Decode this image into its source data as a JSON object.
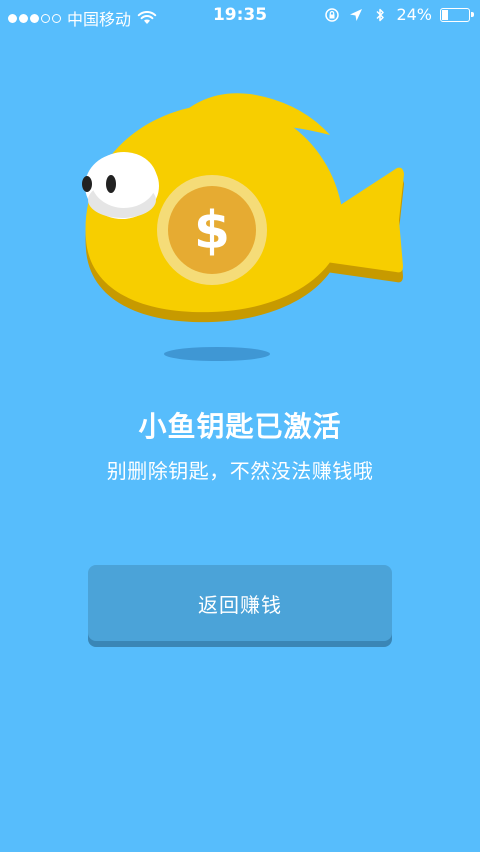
{
  "status_bar": {
    "carrier": "中国移动",
    "time": "19:35",
    "battery_percent": "24%",
    "battery_level": 0.24,
    "icons": [
      "signal-dots",
      "wifi-icon",
      "orientation-lock-icon",
      "location-arrow-icon",
      "bluetooth-icon",
      "battery-icon"
    ]
  },
  "illustration": {
    "name": "yellow-fish-with-dollar-coin",
    "coin_symbol": "$",
    "colors": {
      "background": "#57bdfc",
      "fish_body": "#f7ce00",
      "fish_shadow": "#c79a00",
      "coin_outer": "#f5dc78",
      "coin_inner": "#e6ab32"
    }
  },
  "main": {
    "title": "小鱼钥匙已激活",
    "subtitle": "别删除钥匙，不然没法赚钱哦"
  },
  "actions": {
    "return_button_label": "返回赚钱"
  }
}
